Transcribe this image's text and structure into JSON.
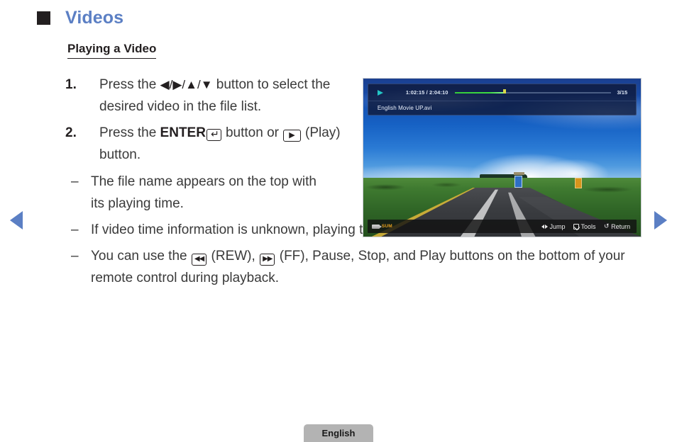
{
  "nav": {
    "prev_label": "previous-page",
    "next_label": "next-page"
  },
  "heading": {
    "title": "Videos",
    "subtitle": "Playing a Video",
    "title_color": "#5b7fc4"
  },
  "steps": [
    {
      "number": "1.",
      "text_before": "Press the ",
      "dpad": "◀/▶/▲/▼",
      "text_after": " button to select the desired video in the file list."
    },
    {
      "number": "2.",
      "text_before": "Press the ",
      "enter_label": "ENTER",
      "enter_icon": "↵",
      "text_mid": " button or ",
      "play_icon": "▶",
      "text_after": " (Play) button."
    }
  ],
  "subitems": [
    {
      "dash": "–",
      "text": "The file name appears on the top with its playing time."
    },
    {
      "dash": "–",
      "text": "If video time information is unknown, playing time and the progress bar are not displayed."
    },
    {
      "dash": "–",
      "text_1": "You can use the ",
      "rew_icon": "◀◀",
      "text_2": " (REW), ",
      "ff_icon": "▶▶",
      "text_3": " (FF), Pause, Stop, and Play buttons on the bottom of your remote control during playback."
    }
  ],
  "tv": {
    "play_state_icon": "play-triangle",
    "time": "1:02:15 / 2:04:10",
    "progress_percent": 32,
    "count": "3/15",
    "filename": "English Movie UP.avi",
    "sum_label": "SUM",
    "hints": [
      {
        "icon": "jump-arrows-icon",
        "label": "Jump"
      },
      {
        "icon": "tools-icon",
        "label": "Tools"
      },
      {
        "icon": "return-icon",
        "label": "Return"
      }
    ],
    "colors": {
      "progress_fill": "#3ddc42",
      "play_icon": "#23c6c6",
      "sum_text": "#e8a020"
    }
  },
  "footer": {
    "language": "English"
  }
}
